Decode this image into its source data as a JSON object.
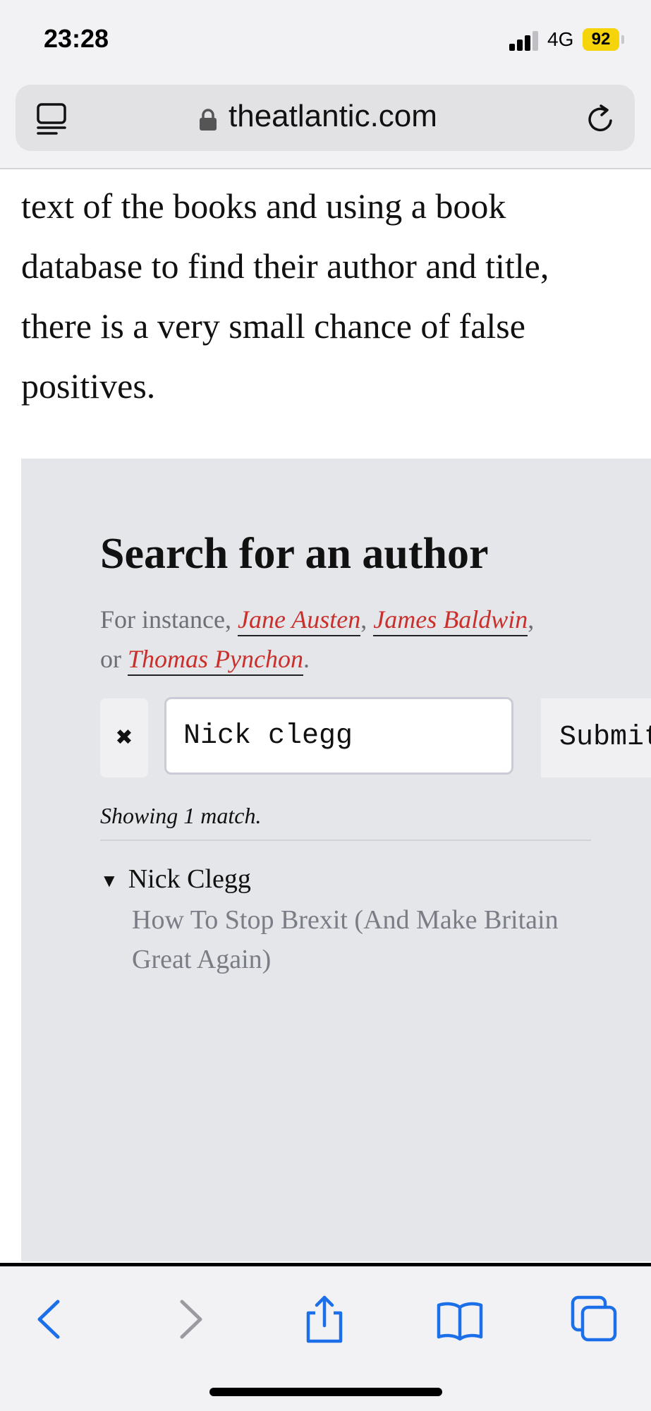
{
  "status": {
    "time": "23:28",
    "network": "4G",
    "battery": "92"
  },
  "browser": {
    "url": "theatlantic.com"
  },
  "article": {
    "paragraph": "text of the books and using a book database to find their author and title, there is a very small chance of false positives."
  },
  "search": {
    "title": "Search for an author",
    "instance_prefix": "For instance, ",
    "examples": [
      "Jane Austen",
      "James Baldwin",
      "Thomas Pynchon"
    ],
    "sep1": ", ",
    "sep2": ",",
    "or": "or ",
    "end": ".",
    "clear_label": "✖",
    "input_value": "Nick clegg",
    "submit_label": "Submit",
    "results_summary": "Showing 1 match.",
    "result_author": "Nick Clegg",
    "result_book": "How To Stop Brexit (And Make Britain Great Again)",
    "expand_glyph": "▼"
  },
  "colors": {
    "link": "#c9302c",
    "accent": "#1b6fe8",
    "panel": "#e5e6ea"
  },
  "toolbar": {
    "icons": [
      "back-icon",
      "forward-icon",
      "share-icon",
      "bookmarks-icon",
      "tabs-icon"
    ]
  }
}
